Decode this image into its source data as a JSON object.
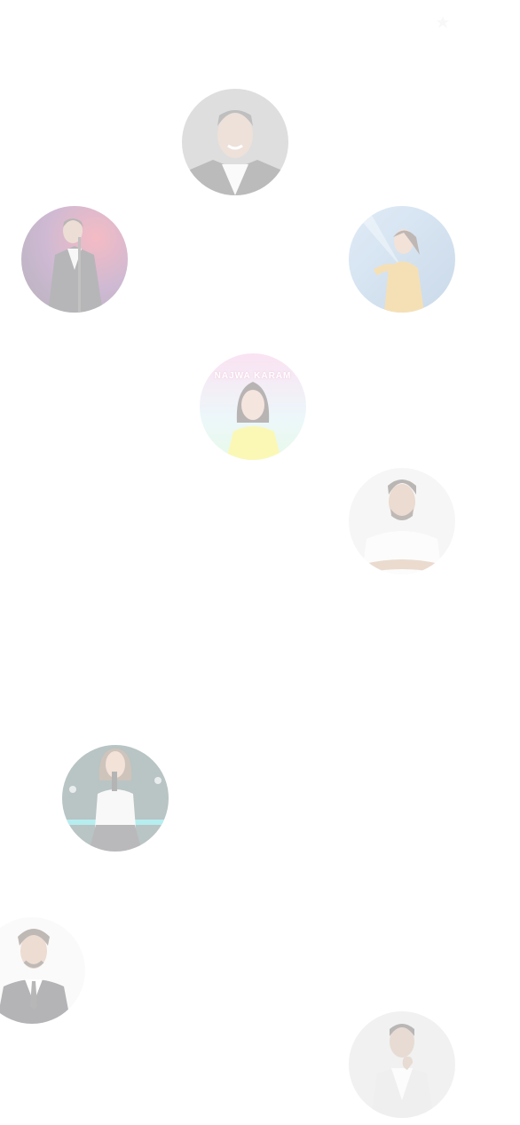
{
  "page": {
    "background": "#ffffff"
  },
  "artists": [
    {
      "id": "amr-diab",
      "caption": ""
    },
    {
      "id": "singer-stage-suit",
      "caption": ""
    },
    {
      "id": "singer-yellow-dress",
      "caption": ""
    },
    {
      "id": "najwa-karam",
      "caption": "NAJWA KARAM"
    },
    {
      "id": "singer-white-tshirt",
      "caption": ""
    },
    {
      "id": "singer-microphone",
      "caption": ""
    },
    {
      "id": "singer-vest-tie",
      "caption": ""
    },
    {
      "id": "singer-formal-pose",
      "caption": ""
    }
  ],
  "style": {
    "avatar_opacity": 0.32
  }
}
